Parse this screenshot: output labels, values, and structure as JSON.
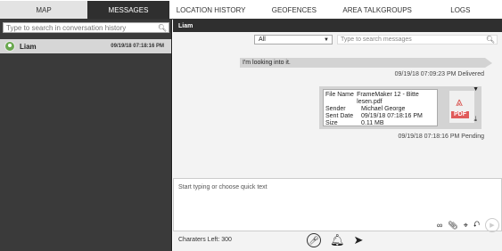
{
  "nav": {
    "tabs": [
      {
        "label": "MAP"
      },
      {
        "label": "MESSAGES"
      },
      {
        "label": "LOCATION HISTORY"
      },
      {
        "label": "GEOFENCES"
      },
      {
        "label": "AREA TALKGROUPS"
      },
      {
        "label": "LOGS"
      }
    ]
  },
  "left": {
    "search_placeholder": "Type to search in conversation history",
    "conversation": {
      "name": "Liam",
      "time": "09/19/18 07:18:16 PM"
    }
  },
  "right": {
    "title": "Liam",
    "filter": {
      "selected": "All"
    },
    "message_search_placeholder": "Type to search messages",
    "messages": [
      {
        "text": "I'm looking into it.",
        "meta": "09/19/18 07:09:23 PM Delivered"
      }
    ],
    "file_message": {
      "fields": [
        {
          "key": "File Name",
          "value": "FrameMaker 12 - Bitte lesen.pdf"
        },
        {
          "key": "Sender",
          "value": "Michael George"
        },
        {
          "key": "Sent Date",
          "value": "09/19/18 07:18:16 PM"
        },
        {
          "key": "Size",
          "value": "0.11 MB"
        }
      ],
      "badge": "PDF",
      "meta": "09/19/18 07:18:16 PM Pending"
    },
    "compose_placeholder": "Start typing or choose quick text",
    "chars_left": "Charaters Left: 300"
  }
}
